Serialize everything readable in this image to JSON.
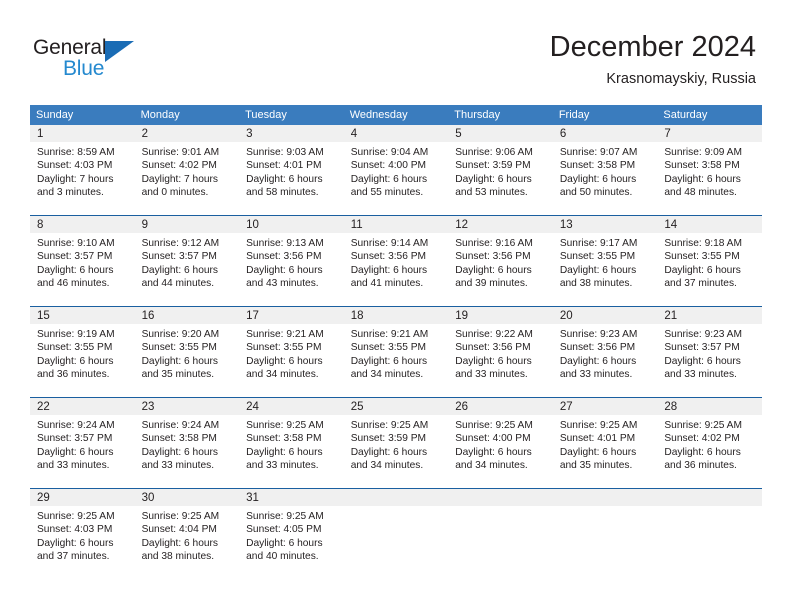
{
  "brand": {
    "name_part1": "General",
    "name_part2": "Blue",
    "triangle_color": "#1a6cb5",
    "blue_text_color": "#2489cf"
  },
  "header": {
    "title": "December 2024",
    "subtitle": "Krasnomayskiy, Russia"
  },
  "theme": {
    "header_row_bg": "#3a7cbe",
    "day_number_bg": "#f0f0f0",
    "row_divider": "#1a5fa0",
    "text": "#231f20"
  },
  "calendar": {
    "weekday_headers": [
      "Sunday",
      "Monday",
      "Tuesday",
      "Wednesday",
      "Thursday",
      "Friday",
      "Saturday"
    ],
    "weeks": [
      [
        {
          "day": "1",
          "sunrise": "Sunrise: 8:59 AM",
          "sunset": "Sunset: 4:03 PM",
          "daylight_line1": "Daylight: 7 hours",
          "daylight_line2": "and 3 minutes."
        },
        {
          "day": "2",
          "sunrise": "Sunrise: 9:01 AM",
          "sunset": "Sunset: 4:02 PM",
          "daylight_line1": "Daylight: 7 hours",
          "daylight_line2": "and 0 minutes."
        },
        {
          "day": "3",
          "sunrise": "Sunrise: 9:03 AM",
          "sunset": "Sunset: 4:01 PM",
          "daylight_line1": "Daylight: 6 hours",
          "daylight_line2": "and 58 minutes."
        },
        {
          "day": "4",
          "sunrise": "Sunrise: 9:04 AM",
          "sunset": "Sunset: 4:00 PM",
          "daylight_line1": "Daylight: 6 hours",
          "daylight_line2": "and 55 minutes."
        },
        {
          "day": "5",
          "sunrise": "Sunrise: 9:06 AM",
          "sunset": "Sunset: 3:59 PM",
          "daylight_line1": "Daylight: 6 hours",
          "daylight_line2": "and 53 minutes."
        },
        {
          "day": "6",
          "sunrise": "Sunrise: 9:07 AM",
          "sunset": "Sunset: 3:58 PM",
          "daylight_line1": "Daylight: 6 hours",
          "daylight_line2": "and 50 minutes."
        },
        {
          "day": "7",
          "sunrise": "Sunrise: 9:09 AM",
          "sunset": "Sunset: 3:58 PM",
          "daylight_line1": "Daylight: 6 hours",
          "daylight_line2": "and 48 minutes."
        }
      ],
      [
        {
          "day": "8",
          "sunrise": "Sunrise: 9:10 AM",
          "sunset": "Sunset: 3:57 PM",
          "daylight_line1": "Daylight: 6 hours",
          "daylight_line2": "and 46 minutes."
        },
        {
          "day": "9",
          "sunrise": "Sunrise: 9:12 AM",
          "sunset": "Sunset: 3:57 PM",
          "daylight_line1": "Daylight: 6 hours",
          "daylight_line2": "and 44 minutes."
        },
        {
          "day": "10",
          "sunrise": "Sunrise: 9:13 AM",
          "sunset": "Sunset: 3:56 PM",
          "daylight_line1": "Daylight: 6 hours",
          "daylight_line2": "and 43 minutes."
        },
        {
          "day": "11",
          "sunrise": "Sunrise: 9:14 AM",
          "sunset": "Sunset: 3:56 PM",
          "daylight_line1": "Daylight: 6 hours",
          "daylight_line2": "and 41 minutes."
        },
        {
          "day": "12",
          "sunrise": "Sunrise: 9:16 AM",
          "sunset": "Sunset: 3:56 PM",
          "daylight_line1": "Daylight: 6 hours",
          "daylight_line2": "and 39 minutes."
        },
        {
          "day": "13",
          "sunrise": "Sunrise: 9:17 AM",
          "sunset": "Sunset: 3:55 PM",
          "daylight_line1": "Daylight: 6 hours",
          "daylight_line2": "and 38 minutes."
        },
        {
          "day": "14",
          "sunrise": "Sunrise: 9:18 AM",
          "sunset": "Sunset: 3:55 PM",
          "daylight_line1": "Daylight: 6 hours",
          "daylight_line2": "and 37 minutes."
        }
      ],
      [
        {
          "day": "15",
          "sunrise": "Sunrise: 9:19 AM",
          "sunset": "Sunset: 3:55 PM",
          "daylight_line1": "Daylight: 6 hours",
          "daylight_line2": "and 36 minutes."
        },
        {
          "day": "16",
          "sunrise": "Sunrise: 9:20 AM",
          "sunset": "Sunset: 3:55 PM",
          "daylight_line1": "Daylight: 6 hours",
          "daylight_line2": "and 35 minutes."
        },
        {
          "day": "17",
          "sunrise": "Sunrise: 9:21 AM",
          "sunset": "Sunset: 3:55 PM",
          "daylight_line1": "Daylight: 6 hours",
          "daylight_line2": "and 34 minutes."
        },
        {
          "day": "18",
          "sunrise": "Sunrise: 9:21 AM",
          "sunset": "Sunset: 3:55 PM",
          "daylight_line1": "Daylight: 6 hours",
          "daylight_line2": "and 34 minutes."
        },
        {
          "day": "19",
          "sunrise": "Sunrise: 9:22 AM",
          "sunset": "Sunset: 3:56 PM",
          "daylight_line1": "Daylight: 6 hours",
          "daylight_line2": "and 33 minutes."
        },
        {
          "day": "20",
          "sunrise": "Sunrise: 9:23 AM",
          "sunset": "Sunset: 3:56 PM",
          "daylight_line1": "Daylight: 6 hours",
          "daylight_line2": "and 33 minutes."
        },
        {
          "day": "21",
          "sunrise": "Sunrise: 9:23 AM",
          "sunset": "Sunset: 3:57 PM",
          "daylight_line1": "Daylight: 6 hours",
          "daylight_line2": "and 33 minutes."
        }
      ],
      [
        {
          "day": "22",
          "sunrise": "Sunrise: 9:24 AM",
          "sunset": "Sunset: 3:57 PM",
          "daylight_line1": "Daylight: 6 hours",
          "daylight_line2": "and 33 minutes."
        },
        {
          "day": "23",
          "sunrise": "Sunrise: 9:24 AM",
          "sunset": "Sunset: 3:58 PM",
          "daylight_line1": "Daylight: 6 hours",
          "daylight_line2": "and 33 minutes."
        },
        {
          "day": "24",
          "sunrise": "Sunrise: 9:25 AM",
          "sunset": "Sunset: 3:58 PM",
          "daylight_line1": "Daylight: 6 hours",
          "daylight_line2": "and 33 minutes."
        },
        {
          "day": "25",
          "sunrise": "Sunrise: 9:25 AM",
          "sunset": "Sunset: 3:59 PM",
          "daylight_line1": "Daylight: 6 hours",
          "daylight_line2": "and 34 minutes."
        },
        {
          "day": "26",
          "sunrise": "Sunrise: 9:25 AM",
          "sunset": "Sunset: 4:00 PM",
          "daylight_line1": "Daylight: 6 hours",
          "daylight_line2": "and 34 minutes."
        },
        {
          "day": "27",
          "sunrise": "Sunrise: 9:25 AM",
          "sunset": "Sunset: 4:01 PM",
          "daylight_line1": "Daylight: 6 hours",
          "daylight_line2": "and 35 minutes."
        },
        {
          "day": "28",
          "sunrise": "Sunrise: 9:25 AM",
          "sunset": "Sunset: 4:02 PM",
          "daylight_line1": "Daylight: 6 hours",
          "daylight_line2": "and 36 minutes."
        }
      ],
      [
        {
          "day": "29",
          "sunrise": "Sunrise: 9:25 AM",
          "sunset": "Sunset: 4:03 PM",
          "daylight_line1": "Daylight: 6 hours",
          "daylight_line2": "and 37 minutes."
        },
        {
          "day": "30",
          "sunrise": "Sunrise: 9:25 AM",
          "sunset": "Sunset: 4:04 PM",
          "daylight_line1": "Daylight: 6 hours",
          "daylight_line2": "and 38 minutes."
        },
        {
          "day": "31",
          "sunrise": "Sunrise: 9:25 AM",
          "sunset": "Sunset: 4:05 PM",
          "daylight_line1": "Daylight: 6 hours",
          "daylight_line2": "and 40 minutes."
        },
        {
          "day": "",
          "sunrise": "",
          "sunset": "",
          "daylight_line1": "",
          "daylight_line2": ""
        },
        {
          "day": "",
          "sunrise": "",
          "sunset": "",
          "daylight_line1": "",
          "daylight_line2": ""
        },
        {
          "day": "",
          "sunrise": "",
          "sunset": "",
          "daylight_line1": "",
          "daylight_line2": ""
        },
        {
          "day": "",
          "sunrise": "",
          "sunset": "",
          "daylight_line1": "",
          "daylight_line2": ""
        }
      ]
    ]
  }
}
